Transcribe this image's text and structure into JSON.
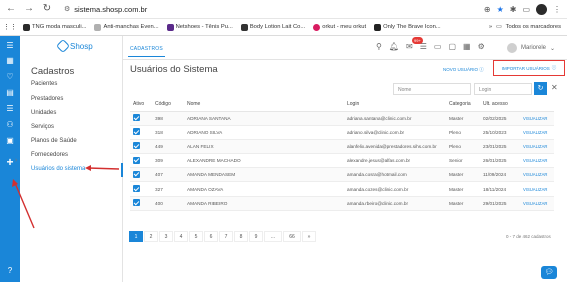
{
  "browser": {
    "url": "sistema.shosp.com.br",
    "bookmarks": [
      {
        "label": "TNG moda masculi...",
        "color": "#2a2a2a"
      },
      {
        "label": "Anti-manchas Even...",
        "color": "#b0b0b0"
      },
      {
        "label": "Netshoes - Tênis Pu...",
        "color": "#5a2a8a"
      },
      {
        "label": "Body Lotion Lait Co...",
        "color": "#333333"
      },
      {
        "label": "orkut - meu orkut",
        "color": "#d81b60"
      },
      {
        "label": "Only The Brave Icon...",
        "color": "#222222"
      }
    ],
    "all_bookmarks": "Todos os marcadores"
  },
  "app": {
    "logo": "Shosp",
    "accent": "#1a86d8",
    "header_tab": "CADASTROS",
    "user_name": "Mariorele",
    "notif_badge": "99+"
  },
  "sidebar": {
    "title": "Cadastros",
    "items": [
      {
        "label": "Pacientes"
      },
      {
        "label": "Prestadores"
      },
      {
        "label": "Unidades"
      },
      {
        "label": "Serviços"
      },
      {
        "label": "Planos de Saúde"
      },
      {
        "label": "Fornecedores"
      },
      {
        "label": "Usuários do sistema",
        "active": true
      }
    ]
  },
  "main": {
    "title": "Usuários do Sistema",
    "novo_label": "NOVO USUÁRIO",
    "import_label": "IMPORTAR USUÁRIOS",
    "filters": {
      "nome_placeholder": "Nome",
      "login_placeholder": "Login"
    },
    "columns": [
      "Ativo",
      "Código",
      "Nome",
      "Login",
      "Categoria",
      "Ult. acesso",
      ""
    ],
    "rows": [
      {
        "codigo": "398",
        "nome": "ADRIANA SANTANA",
        "login": "adriana.santana@clinic.com.br",
        "categoria": "Master",
        "acesso": "02/02/2025",
        "acao": "VISUALIZAR"
      },
      {
        "codigo": "318",
        "nome": "ADRIANO SILVA",
        "login": "adriano.silva@clinic.com.br",
        "categoria": "Pleno",
        "acesso": "25/10/2023",
        "acao": "VISUALIZAR"
      },
      {
        "codigo": "449",
        "nome": "ALAN FELIX",
        "login": "alanfelix.avenida@prestadores.sihs.com.br",
        "categoria": "Pleno",
        "acesso": "23/01/2025",
        "acao": "VISUALIZAR"
      },
      {
        "codigo": "309",
        "nome": "ALEXANDRE MACHADO",
        "login": "alexandre.jesus@alfas.com.br",
        "categoria": "Senior",
        "acesso": "26/01/2025",
        "acao": "VISUALIZAR"
      },
      {
        "codigo": "407",
        "nome": "AMANDA MENDASEM",
        "login": "amanda.cosra@hotmail.com",
        "categoria": "Master",
        "acesso": "11/09/2024",
        "acao": "VISUALIZAR"
      },
      {
        "codigo": "327",
        "nome": "AMANDA OZAVA",
        "login": "amanda.cozes@clinic.com.br",
        "categoria": "Master",
        "acesso": "18/11/2024",
        "acao": "VISUALIZAR"
      },
      {
        "codigo": "400",
        "nome": "AMANDA RIBEIRO",
        "login": "amanda.rbeiro@clinic.com.br",
        "categoria": "Master",
        "acesso": "29/01/2025",
        "acao": "VISUALIZAR"
      }
    ],
    "pages": [
      "1",
      "2",
      "3",
      "4",
      "5",
      "6",
      "7",
      "8",
      "9",
      "...",
      "66",
      "»"
    ],
    "count_text": "0 - 7 de 462 cadastros"
  }
}
